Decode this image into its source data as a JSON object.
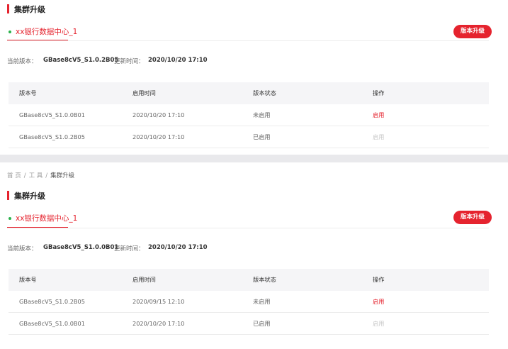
{
  "panels": [
    {
      "title": "集群升级",
      "datacenter": "xx银行数据中心_1",
      "upgrade_button": "版本升级",
      "current_version_label": "当前版本：",
      "current_version": "GBase8cV5_S1.0.2B05",
      "update_time_label": "更新时间：",
      "update_time": "2020/10/20 17:10",
      "columns": [
        "版本号",
        "启用时间",
        "版本状态",
        "操作"
      ],
      "rows": [
        {
          "version": "GBase8cV5_S1.0.0B01",
          "time": "2020/10/20 17:10",
          "status": "未启用",
          "action": "启用"
        },
        {
          "version": "GBase8cV5_S1.0.2B05",
          "time": "2020/10/20 17:10",
          "status": "已启用",
          "action": "启用"
        }
      ]
    },
    {
      "breadcrumb": [
        "首 页",
        "工 具",
        "集群升级"
      ],
      "title": "集群升级",
      "datacenter": "xx银行数据中心_1",
      "upgrade_button": "版本升级",
      "current_version_label": "当前版本：",
      "current_version": "GBase8cV5_S1.0.0B01",
      "update_time_label": "更新时间：",
      "update_time": "2020/10/20 17:10",
      "columns": [
        "版本号",
        "启用时间",
        "版本状态",
        "操作"
      ],
      "rows": [
        {
          "version": "GBase8cV5_S1.0.2B05",
          "time": "2020/09/15 12:10",
          "status": "未启用",
          "action": "启用"
        },
        {
          "version": "GBase8cV5_S1.0.0B01",
          "time": "2020/10/20 17:10",
          "status": "已启用",
          "action": "启用"
        }
      ]
    }
  ],
  "colors": {
    "accent": "#e5232e",
    "active_dot": "#2bb24c",
    "disabled_text": "#c8c8c8",
    "header_bg": "#f5f5f7"
  }
}
